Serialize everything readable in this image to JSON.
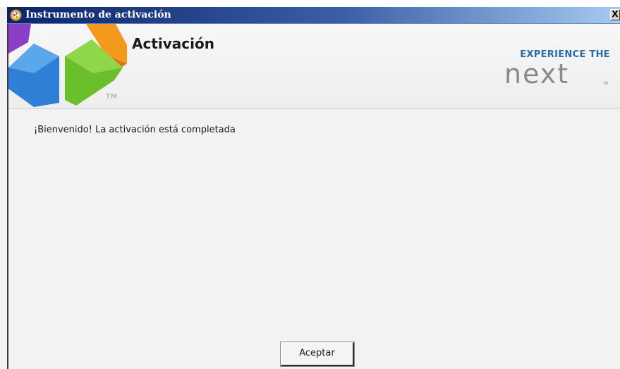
{
  "window": {
    "title": "Instrumento de activación",
    "close_label": "X"
  },
  "header": {
    "heading": "Activación",
    "logo_tm": "TM",
    "brand_top": "EXPERIENCE THE",
    "brand_bottom": "next",
    "brand_tm": "TM"
  },
  "content": {
    "message": "¡Bienvenido! La activación está completada"
  },
  "buttons": {
    "accept_label": "Aceptar"
  },
  "colors": {
    "titlebar_start": "#0a246a",
    "titlebar_end": "#a6caf0",
    "brand_blue": "#2a6aa8",
    "brand_gray": "#8a8a8a",
    "logo_blue": "#2f7fd6",
    "logo_green": "#6bbf2a",
    "logo_orange": "#f39a1e",
    "logo_purple": "#8a3fc6"
  }
}
